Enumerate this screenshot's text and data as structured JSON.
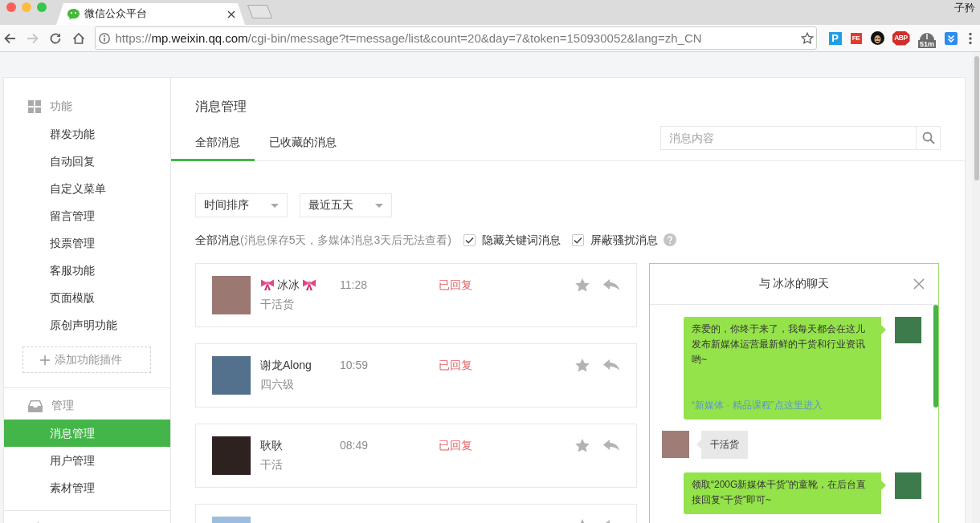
{
  "browser": {
    "tab": {
      "title": "微信公众平台"
    },
    "user": "子矜",
    "nav": [
      {
        "kind": "back",
        "disabled": false
      },
      {
        "kind": "forward",
        "disabled": true
      },
      {
        "kind": "reload",
        "disabled": false
      },
      {
        "kind": "home",
        "disabled": false
      }
    ],
    "url_parts": [
      {
        "kind": "dim",
        "text": "https://"
      },
      {
        "kind": "host",
        "text": "mp.weixin.qq.com"
      },
      {
        "kind": "dim",
        "text": "/cgi-bin/message?t=message/list&count=20&day=7&token=150930052&lang=zh_CN"
      }
    ],
    "extensions": [
      {
        "kind": "letter",
        "label": "P"
      },
      {
        "kind": "boxed",
        "label": "FE"
      },
      {
        "kind": "face"
      },
      {
        "kind": "octagon",
        "label": "ABP"
      },
      {
        "kind": "timer",
        "label": "51m"
      },
      {
        "kind": "chevrons"
      }
    ]
  },
  "sidebar": {
    "sections": [
      {
        "kind": "grid",
        "title": "功能",
        "items": [
          {
            "label": "群发功能",
            "selected": false
          },
          {
            "label": "自动回复",
            "selected": false
          },
          {
            "label": "自定义菜单",
            "selected": false
          },
          {
            "label": "留言管理",
            "selected": false
          },
          {
            "label": "投票管理",
            "selected": false
          },
          {
            "label": "客服功能",
            "selected": false
          },
          {
            "label": "页面模版",
            "selected": false
          },
          {
            "label": "原创声明功能",
            "selected": false
          }
        ],
        "add_button": "添加功能插件"
      },
      {
        "kind": "inbox",
        "title": "管理",
        "items": [
          {
            "label": "消息管理",
            "selected": true
          },
          {
            "label": "用户管理",
            "selected": false
          },
          {
            "label": "素材管理",
            "selected": false
          }
        ]
      },
      {
        "kind": "megaphone"
      }
    ]
  },
  "page": {
    "title": "消息管理",
    "tabs": [
      {
        "label": "全部消息",
        "selected": true
      },
      {
        "label": "已收藏的消息",
        "selected": false
      }
    ],
    "search": {
      "placeholder": "消息内容"
    },
    "filters": [
      {
        "value": "时间排序"
      },
      {
        "value": "最近五天"
      }
    ],
    "summary": {
      "label": "全部消息",
      "note": "(消息保存5天，多媒体消息3天后无法查看)"
    },
    "options": [
      {
        "label": "隐藏关键词消息",
        "checked": true
      },
      {
        "label": "屏蔽骚扰消息",
        "checked": true
      }
    ],
    "messages": [
      {
        "kind": "full",
        "name": "冰冰",
        "bows": true,
        "preview": "干活货",
        "time": "11:28",
        "status": "已回复"
      },
      {
        "kind": "full",
        "name": "谢龙Along",
        "bows": false,
        "preview": "四六级",
        "time": "10:59",
        "status": "已回复"
      },
      {
        "kind": "full",
        "name": "耿耿",
        "bows": false,
        "preview": "干活",
        "time": "08:49",
        "status": "已回复"
      },
      {
        "kind": "cut"
      }
    ]
  },
  "chat": {
    "title": "与 冰冰的聊天",
    "messages": [
      {
        "kind": "outgoing",
        "text": "亲爱的，你终于来了，我每天都会在这儿发布新媒体运营最新鲜的干货和行业资讯哟~",
        "link": "“新媒体 · 精品课程”点这里进入"
      },
      {
        "kind": "incoming",
        "text": "干活货"
      },
      {
        "kind": "outgoing",
        "text": "领取“200G新媒体干货”的童靴，在后台直接回复“干货”即可~"
      }
    ]
  }
}
